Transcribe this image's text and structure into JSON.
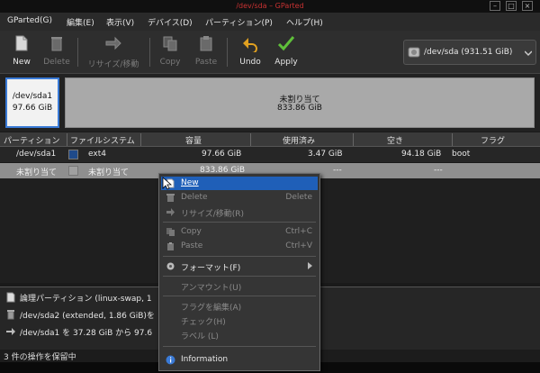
{
  "window": {
    "title": "/dev/sda – GParted"
  },
  "menubar": [
    "GParted(G)",
    "編集(E)",
    "表示(V)",
    "デバイス(D)",
    "パーティション(P)",
    "ヘルプ(H)"
  ],
  "toolbar": {
    "new": "New",
    "delete": "Delete",
    "resize": "リサイズ/移動",
    "copy": "Copy",
    "paste": "Paste",
    "undo": "Undo",
    "apply": "Apply"
  },
  "device_selector": {
    "label": "/dev/sda   (931.51 GiB)"
  },
  "disk_map": {
    "part1": {
      "name": "/dev/sda1",
      "size": "97.66 GiB"
    },
    "unallocated": {
      "name": "未割り当て",
      "size": "833.86 GiB"
    }
  },
  "table": {
    "headers": [
      "パーティション",
      "ファイルシステム",
      "容量",
      "使用済み",
      "空き",
      "フラグ"
    ],
    "rows": [
      {
        "partition": "/dev/sda1",
        "filesystem": "ext4",
        "size": "97.66 GiB",
        "used": "3.47 GiB",
        "free": "94.18 GiB",
        "flags": "boot",
        "color": "#1f4a8a"
      },
      {
        "partition": "未割り当て",
        "filesystem": "未割り当て",
        "size": "833.86 GiB",
        "used": "---",
        "free": "---",
        "flags": "",
        "color": "#a0a0a0"
      }
    ]
  },
  "operations": [
    "論理パーティション (linux-swap, 1",
    "/dev/sda2 (extended, 1.86 GiB)を",
    "/dev/sda1 を 37.28 GiB から 97.6"
  ],
  "status": {
    "text": "3 件の操作を保留中"
  },
  "context_menu": {
    "new": "New",
    "delete": "Delete",
    "delete_key": "Delete",
    "resize": "リサイズ/移動(R)",
    "copy": "Copy",
    "copy_key": "Ctrl+C",
    "paste": "Paste",
    "paste_key": "Ctrl+V",
    "format": "フォーマット(F)",
    "unmount": "アンマウント(U)",
    "flags": "フラグを編集(A)",
    "check": "チェック(H)",
    "label": "ラベル (L)",
    "info": "Information"
  },
  "colors": {
    "selection": "#1f5fb8",
    "partition_border": "#3a7ad6",
    "ext4": "#1f4a8a",
    "unallocated": "#a9a9a9"
  }
}
